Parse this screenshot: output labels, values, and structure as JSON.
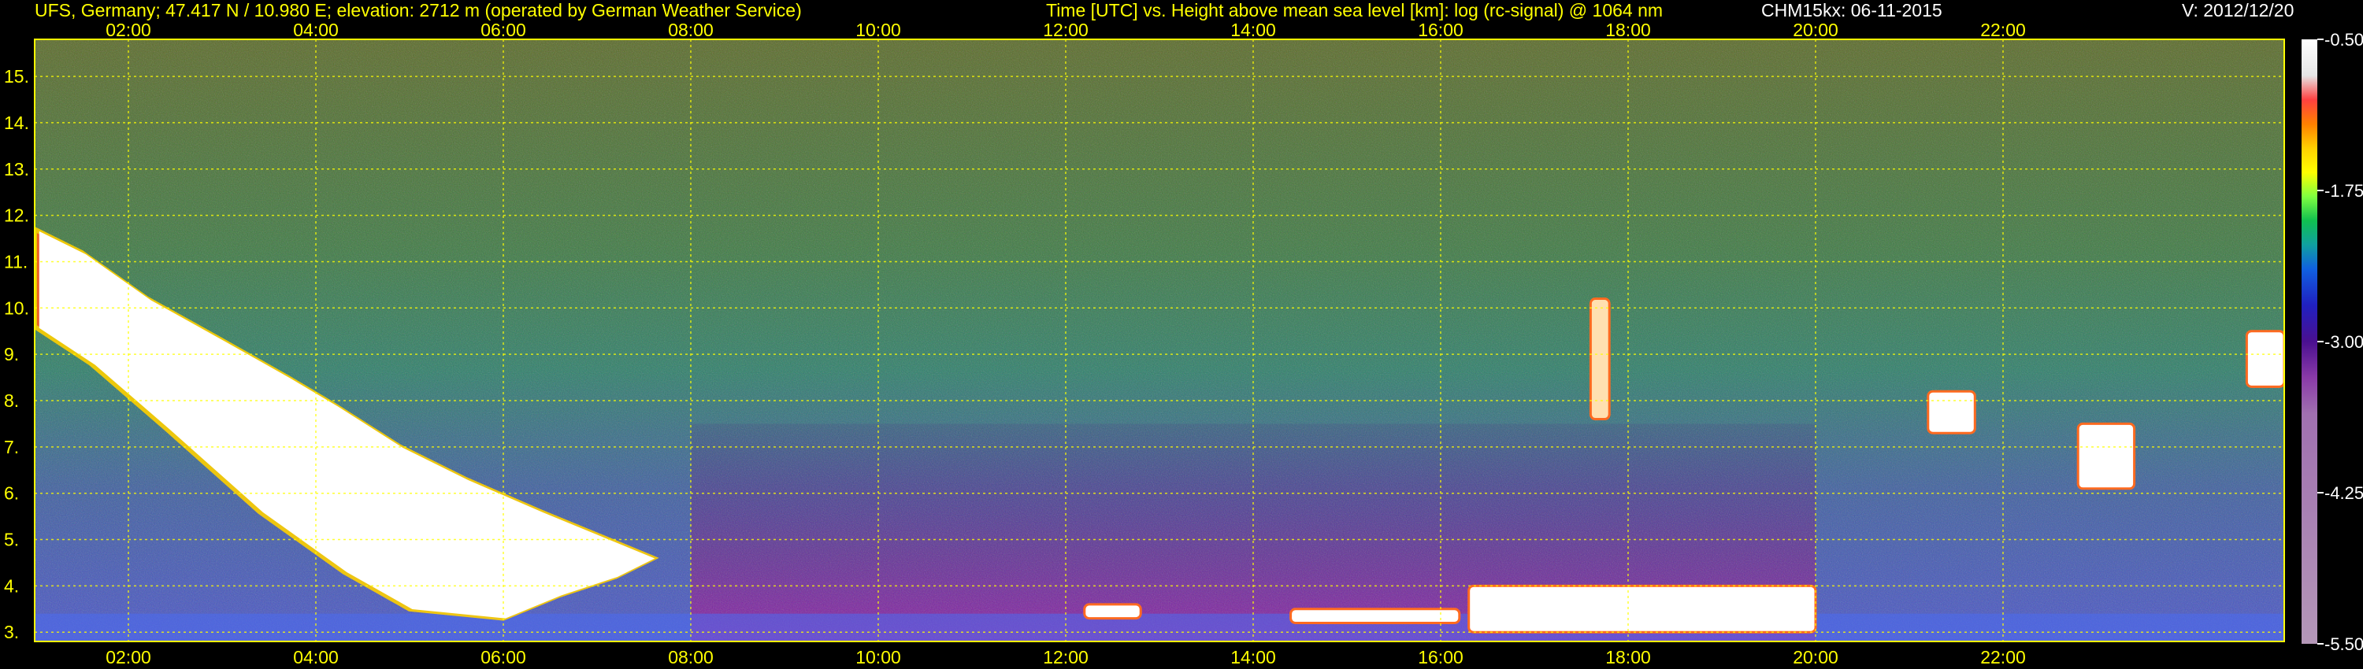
{
  "header": {
    "station": "UFS, Germany; 47.417 N / 10.980 E; elevation: 2712 m  (operated by German Weather Service)",
    "axis_desc": "Time [UTC] vs. Height above mean sea level [km]: log (rc-signal) @ 1064 nm",
    "instrument_date": "CHM15kx: 06-11-2015",
    "version": "V: 2012/12/20"
  },
  "chart_data": {
    "type": "heatmap",
    "xlabel": "Time [UTC]",
    "ylabel": "Height above mean sea level [km]",
    "x_ticks": [
      "02:00",
      "04:00",
      "06:00",
      "08:00",
      "10:00",
      "12:00",
      "14:00",
      "16:00",
      "18:00",
      "20:00",
      "22:00"
    ],
    "x_tick_hours": [
      2,
      4,
      6,
      8,
      10,
      12,
      14,
      16,
      18,
      20,
      22
    ],
    "xlim_hours": [
      1,
      25
    ],
    "y_ticks": [
      "3.",
      "4.",
      "5.",
      "6.",
      "7.",
      "8.",
      "9.",
      "10.",
      "11.",
      "12.",
      "13.",
      "14.",
      "15."
    ],
    "y_tick_km": [
      3,
      4,
      5,
      6,
      7,
      8,
      9,
      10,
      11,
      12,
      13,
      14,
      15
    ],
    "ylim_km": [
      2.8,
      15.8
    ],
    "colorbar": {
      "ticks": [
        "-0.50",
        "-1.75",
        "-3.00",
        "-4.25",
        "-5.50"
      ],
      "values": [
        -0.5,
        -1.75,
        -3.0,
        -4.25,
        -5.5
      ],
      "range": [
        -5.5,
        -0.5
      ]
    },
    "grid": true,
    "colors": {
      "text": "#ffff00",
      "grid": "#ffff00",
      "background": "#000000",
      "cloud": "#ffffff",
      "aerosol_layer": "#7a1fa0",
      "noise": "#2e8b57"
    },
    "features": [
      {
        "kind": "cloud",
        "t": [
          1.0,
          7.6
        ],
        "z": [
          3.1,
          11.7
        ]
      },
      {
        "kind": "cloud",
        "t": [
          12.2,
          12.8
        ],
        "z": [
          3.3,
          3.6
        ]
      },
      {
        "kind": "cloud",
        "t": [
          14.4,
          16.2
        ],
        "z": [
          3.2,
          3.5
        ]
      },
      {
        "kind": "cloud",
        "t": [
          16.3,
          20.0
        ],
        "z": [
          3.0,
          4.0
        ]
      },
      {
        "kind": "cloud",
        "t": [
          21.2,
          21.7
        ],
        "z": [
          7.3,
          8.2
        ]
      },
      {
        "kind": "cloud",
        "t": [
          22.8,
          23.4
        ],
        "z": [
          6.1,
          7.5
        ]
      },
      {
        "kind": "cloud",
        "t": [
          24.6,
          25.0
        ],
        "z": [
          8.3,
          9.5
        ]
      },
      {
        "kind": "virga",
        "t": [
          17.6,
          17.8
        ],
        "z": [
          7.6,
          10.2
        ]
      }
    ]
  }
}
